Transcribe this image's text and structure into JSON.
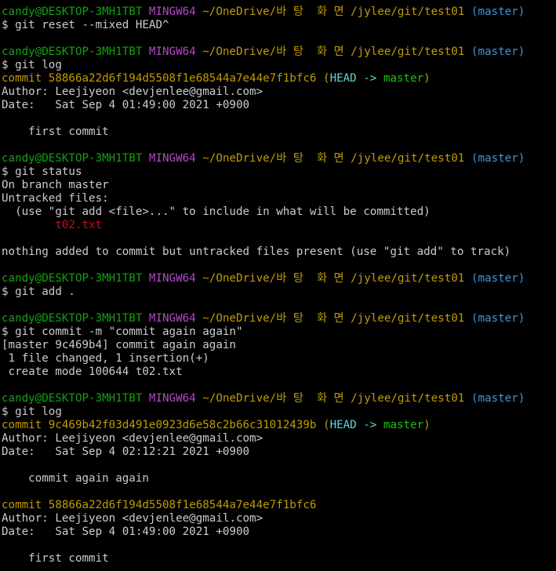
{
  "colors": {
    "background": "#000000",
    "text": "#cccccc",
    "user_host": "#13a10e",
    "mingw": "#b148c6",
    "path": "#c19c00",
    "branch": "#3a96dd",
    "untracked_file": "#c50f1f",
    "head_ref": "#61d6d6",
    "branch_ref": "#16c60c"
  },
  "prompts": [
    {
      "user_host": "candy@DESKTOP-3MH1TBT",
      "env": "MINGW64",
      "path": "~/OneDrive/바 탕  화 면 /jylee/git/test01",
      "branch": "(master)"
    },
    {
      "user_host": "candy@DESKTOP-3MH1TBT",
      "env": "MINGW64",
      "path": "~/OneDrive/바 탕  화 면 /jylee/git/test01",
      "branch": "(master)"
    },
    {
      "user_host": "candy@DESKTOP-3MH1TBT",
      "env": "MINGW64",
      "path": "~/OneDrive/바 탕  화 면 /jylee/git/test01",
      "branch": "(master)"
    },
    {
      "user_host": "candy@DESKTOP-3MH1TBT",
      "env": "MINGW64",
      "path": "~/OneDrive/바 탕  화 면 /jylee/git/test01",
      "branch": "(master)"
    },
    {
      "user_host": "candy@DESKTOP-3MH1TBT",
      "env": "MINGW64",
      "path": "~/OneDrive/바 탕  화 면 /jylee/git/test01",
      "branch": "(master)"
    },
    {
      "user_host": "candy@DESKTOP-3MH1TBT",
      "env": "MINGW64",
      "path": "~/OneDrive/바 탕  화 면 /jylee/git/test01",
      "branch": "(master)"
    }
  ],
  "commands": [
    "$ git reset --mixed HEAD^",
    "$ git log",
    "$ git status",
    "$ git add .",
    "$ git commit -m \"commit again again\"",
    "$ git log"
  ],
  "log1": {
    "commit_prefix": "commit 58866a22d6f194d5508f1e68544a7e44e7f1bfc6",
    "ref_open": " (",
    "head": "HEAD ->",
    "ref_branch": " master",
    "ref_close": ")",
    "author": "Author: Leejiyeon <devjenlee@gmail.com>",
    "date": "Date:   Sat Sep 4 01:49:00 2021 +0900",
    "message": "    first commit"
  },
  "status": {
    "on_branch": "On branch master",
    "untracked_header": "Untracked files:",
    "hint": "  (use \"git add <file>...\" to include in what will be committed)",
    "file": "        t02.txt",
    "nothing_added": "nothing added to commit but untracked files present (use \"git add\" to track)"
  },
  "commit_result": {
    "line1": "[master 9c469b4] commit again again",
    "line2": " 1 file changed, 1 insertion(+)",
    "line3": " create mode 100644 t02.txt"
  },
  "log2": {
    "commit_a": "commit 9c469b42f03d491e0923d6e58c2b66c31012439b",
    "ref_open": " (",
    "head": "HEAD ->",
    "ref_branch": " master",
    "ref_close": ")",
    "author_a": "Author: Leejiyeon <devjenlee@gmail.com>",
    "date_a": "Date:   Sat Sep 4 02:12:21 2021 +0900",
    "message_a": "    commit again again",
    "commit_b": "commit 58866a22d6f194d5508f1e68544a7e44e7f1bfc6",
    "author_b": "Author: Leejiyeon <devjenlee@gmail.com>",
    "date_b": "Date:   Sat Sep 4 01:49:00 2021 +0900",
    "message_b": "    first commit"
  }
}
